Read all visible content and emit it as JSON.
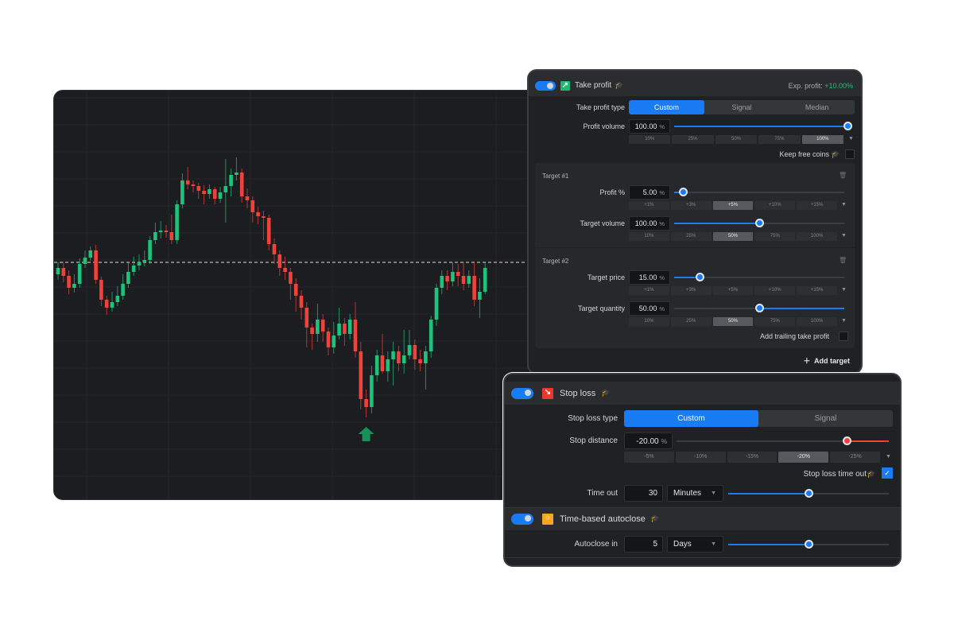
{
  "chart_data": {
    "type": "candlestick",
    "ylim": [
      0,
      103
    ],
    "reference_line": 60,
    "signal_marker": {
      "type": "buy-arrow",
      "candle_index": 57
    },
    "colors": {
      "up": "#1fc27a",
      "down": "#f2413a",
      "reference": "#e9dfc0",
      "marker": "#17915a"
    },
    "ohlc": [
      [
        57,
        60,
        55.6,
        58.6
      ],
      [
        58.6,
        60.2,
        55,
        56.6
      ],
      [
        56.6,
        58,
        52,
        53.6
      ],
      [
        53.6,
        57,
        52.4,
        54.6
      ],
      [
        54.6,
        61,
        53.6,
        59.6
      ],
      [
        59.6,
        63,
        58.6,
        61.2
      ],
      [
        61.2,
        64,
        60.4,
        63
      ],
      [
        63,
        64.4,
        54.6,
        55.6
      ],
      [
        55.6,
        56.4,
        49,
        50.6
      ],
      [
        50.6,
        51.6,
        46.8,
        48.6
      ],
      [
        48.6,
        52.6,
        47.6,
        50
      ],
      [
        50,
        54,
        49,
        51.6
      ],
      [
        51.6,
        57,
        50.6,
        54.6
      ],
      [
        54.6,
        60,
        53.6,
        57.6
      ],
      [
        57.6,
        61.4,
        56.6,
        59.2
      ],
      [
        59.2,
        62,
        58,
        60
      ],
      [
        60,
        63,
        59,
        60.6
      ],
      [
        60.6,
        66.6,
        59.6,
        65.6
      ],
      [
        65.6,
        70,
        64.6,
        67.6
      ],
      [
        67.6,
        70.4,
        66,
        68
      ],
      [
        68,
        69.4,
        66.2,
        67.6
      ],
      [
        67.6,
        72,
        64.6,
        65.6
      ],
      [
        65.6,
        75.6,
        64.6,
        74.6
      ],
      [
        74.6,
        82.4,
        73.6,
        80.6
      ],
      [
        80.6,
        84,
        78.4,
        79.6
      ],
      [
        79.6,
        80.6,
        77.6,
        79.2
      ],
      [
        79.2,
        80,
        76,
        78
      ],
      [
        78,
        79.4,
        74.6,
        77.2
      ],
      [
        77.2,
        79.6,
        76,
        78.4
      ],
      [
        78.4,
        79,
        74.6,
        76
      ],
      [
        76,
        79,
        75,
        77.6
      ],
      [
        77.6,
        86,
        70,
        79.2
      ],
      [
        79.2,
        83.6,
        76.6,
        82
      ],
      [
        82,
        86.4,
        80.6,
        82.6
      ],
      [
        82.6,
        83.6,
        75,
        76.6
      ],
      [
        76.6,
        78.6,
        73.6,
        75.6
      ],
      [
        75.6,
        76.6,
        70,
        72.6
      ],
      [
        72.6,
        74,
        69.6,
        71.6
      ],
      [
        71.6,
        73,
        65.6,
        71.2
      ],
      [
        71.2,
        72,
        63,
        64.6
      ],
      [
        64.6,
        66,
        59.6,
        62
      ],
      [
        62,
        63,
        56.6,
        58.6
      ],
      [
        58.6,
        61.4,
        55.6,
        57.6
      ],
      [
        57.6,
        58.6,
        50.6,
        54.6
      ],
      [
        54.6,
        56,
        47.6,
        51.6
      ],
      [
        51.6,
        53,
        45.6,
        48.6
      ],
      [
        48.6,
        50,
        38.6,
        43.6
      ],
      [
        43.6,
        44.6,
        38,
        42
      ],
      [
        42,
        49.6,
        40,
        45.6
      ],
      [
        45.6,
        47,
        40,
        42.6
      ],
      [
        42.6,
        43.6,
        36.6,
        38.6
      ],
      [
        38.6,
        45,
        37,
        41.6
      ],
      [
        41.6,
        48.6,
        40.6,
        44.6
      ],
      [
        44.6,
        46,
        39,
        42
      ],
      [
        42,
        47,
        40.6,
        45.6
      ],
      [
        45.6,
        50,
        36,
        37.6
      ],
      [
        37.6,
        40,
        23,
        25.6
      ],
      [
        25.6,
        28,
        21,
        23.6
      ],
      [
        23.6,
        34,
        22,
        31.6
      ],
      [
        31.6,
        38,
        30,
        36.6
      ],
      [
        36.6,
        42,
        32,
        32.6
      ],
      [
        32.6,
        37.6,
        30,
        35.6
      ],
      [
        35.6,
        40,
        29,
        37.6
      ],
      [
        37.6,
        39,
        32.6,
        34.6
      ],
      [
        34.6,
        43,
        32,
        36.6
      ],
      [
        36.6,
        43,
        35.6,
        39.2
      ],
      [
        39.2,
        40.6,
        33,
        35.6
      ],
      [
        35.6,
        38,
        32.6,
        34.6
      ],
      [
        34.6,
        39,
        28,
        37.6
      ],
      [
        37.6,
        46.6,
        36,
        45.6
      ],
      [
        45.6,
        54.6,
        44,
        53.6
      ],
      [
        53.6,
        58,
        52,
        56.6
      ],
      [
        56.6,
        58,
        53,
        55.2
      ],
      [
        55.2,
        60,
        54,
        57.6
      ],
      [
        57.6,
        59.6,
        54,
        56.6
      ],
      [
        56.6,
        60,
        53,
        54.6
      ],
      [
        54.6,
        58,
        53.6,
        56.6
      ],
      [
        56.6,
        60,
        49,
        50.6
      ],
      [
        50.6,
        56,
        46,
        52.6
      ],
      [
        52.6,
        60,
        52,
        58.6
      ]
    ]
  },
  "take_profit": {
    "enabled": true,
    "icon": "arrow-up-right-icon",
    "icon_color": "#1fb86e",
    "title": "Take profit",
    "exp_label": "Exp. profit:",
    "exp_value": "+10.00%",
    "exp_color": "#1fc27a",
    "type_label": "Take profit type",
    "type_options": [
      "Custom",
      "Signal",
      "Median"
    ],
    "type_selected": 0,
    "volume_label": "Profit volume",
    "volume_value": "100.00",
    "unit": "%",
    "volume_slider": 1.0,
    "volume_presets": [
      "10%",
      "25%",
      "50%",
      "75%",
      "100%"
    ],
    "volume_preset_selected": 4,
    "keep_free_coins": "Keep free coins",
    "keep_free_checked": false,
    "targets": [
      {
        "title": "Target #1",
        "row1_label": "Profit %",
        "row1_value": "5.00",
        "row1_slider": 0.05,
        "row1_presets": [
          "+1%",
          "+3%",
          "+5%",
          "+10%",
          "+15%"
        ],
        "row1_selected": 2,
        "row2_label": "Target volume",
        "row2_value": "100.00",
        "row2_slider": 0.5,
        "row2_presets": [
          "10%",
          "25%",
          "50%",
          "75%",
          "100%"
        ],
        "row2_selected": 2
      },
      {
        "title": "Target #2",
        "row1_label": "Target price",
        "row1_value": "15.00",
        "row1_slider": 0.15,
        "row1_presets": [
          "+1%",
          "+3%",
          "+5%",
          "+10%",
          "+15%"
        ],
        "row1_selected": -1,
        "row2_label": "Target quantity",
        "row2_value": "50.00",
        "row2_slider": 0.5,
        "row2_presets": [
          "10%",
          "25%",
          "50%",
          "75%",
          "100%"
        ],
        "row2_selected": 2,
        "trailing_label": "Add trailing take profit",
        "trailing_checked": false
      }
    ],
    "add_target": "Add target"
  },
  "stop_loss": {
    "enabled": true,
    "icon": "arrow-down-right-icon",
    "icon_color": "#e8382f",
    "title": "Stop loss",
    "type_label": "Stop loss type",
    "type_options": [
      "Custom",
      "Signal"
    ],
    "type_selected": 0,
    "distance_label": "Stop distance",
    "distance_value": "-20.00",
    "unit": "%",
    "distance_slider": 0.8,
    "distance_color": "#f2413a",
    "presets": [
      "-5%",
      "-10%",
      "-15%",
      "-20%",
      "-25%"
    ],
    "preset_selected": 3,
    "timeout_check_label": "Stop loss time out",
    "timeout_checked": true,
    "timeout_label": "Time out",
    "timeout_value": "30",
    "timeout_unit": "Minutes",
    "timeout_slider": 0.5
  },
  "autoclose": {
    "enabled": true,
    "icon": "clock-icon",
    "icon_color": "#f5a623",
    "title": "Time-based autoclose",
    "label": "Autoclose in",
    "value": "5",
    "unit": "Days",
    "slider": 0.5
  }
}
